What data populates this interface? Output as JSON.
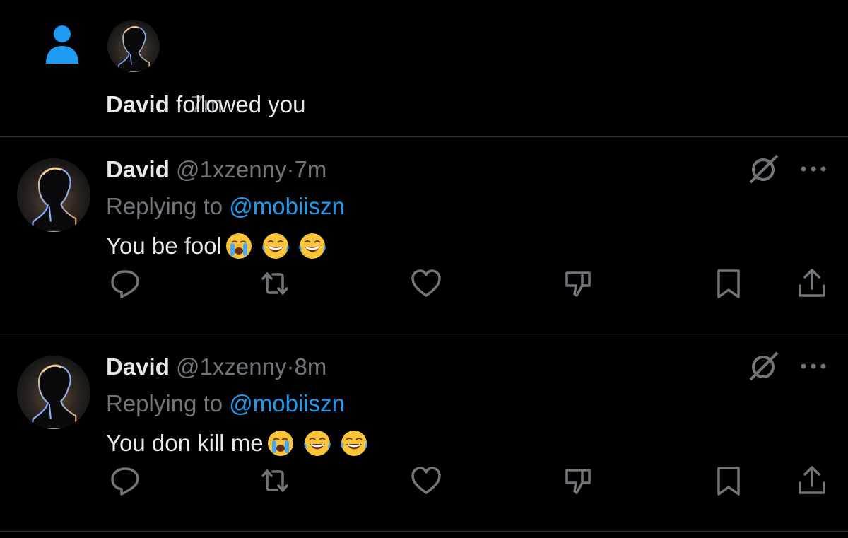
{
  "notification": {
    "user_name": "David",
    "action_text": "followed you",
    "separator": "·",
    "time": "7m",
    "type_icon": "person-icon"
  },
  "tweets": [
    {
      "name": "David",
      "handle": "@1xzenny",
      "separator": "·",
      "time": "7m",
      "replying_prefix": "Replying to",
      "replying_to": "@mobiiszn",
      "text": "You be fool",
      "emojis": [
        "loudly-crying-face",
        "face-with-tears-of-joy",
        "face-with-tears-of-joy"
      ]
    },
    {
      "name": "David",
      "handle": "@1xzenny",
      "separator": "·",
      "time": "8m",
      "replying_prefix": "Replying to",
      "replying_to": "@mobiiszn",
      "text": "You don kill me",
      "emojis": [
        "loudly-crying-face",
        "face-with-tears-of-joy",
        "face-with-tears-of-joy"
      ]
    }
  ],
  "actions": [
    "reply-icon",
    "retweet-icon",
    "like-icon",
    "downvote-icon",
    "bookmark-icon",
    "share-icon"
  ],
  "colors": {
    "background": "#000000",
    "primary_text": "#e7e9ea",
    "secondary_text": "#71767b",
    "accent": "#1d9bf0",
    "divider": "#2f3336",
    "icon": "#71767b"
  }
}
